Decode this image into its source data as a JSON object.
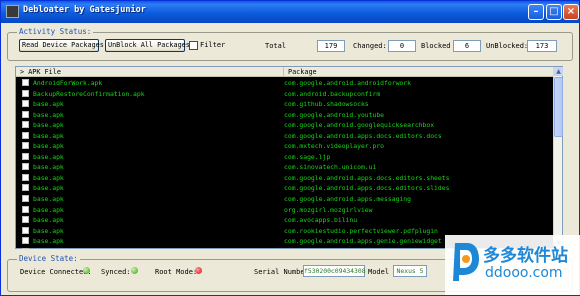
{
  "window": {
    "title": "Debloater by Gatesjunior"
  },
  "activity": {
    "legend": "Activity Status:",
    "read_button": "Read Device Packages",
    "unblock_button": "UnBlock All Packages",
    "filter_label": "Filter",
    "total_label": "Total",
    "total_value": "179",
    "changed_label": "Changed:",
    "changed_value": "0",
    "blocked_label": "Blocked",
    "blocked_value": "6",
    "unblocked_label": "UnBlocked:",
    "unblocked_value": "173"
  },
  "table": {
    "columns": [
      "APK File",
      "Package"
    ],
    "rows": [
      {
        "apk": "AndroidForWork.apk",
        "package": "com.google.android.androidforwork"
      },
      {
        "apk": "BackupRestoreConfirmation.apk",
        "package": "com.android.backupconfirm"
      },
      {
        "apk": "base.apk",
        "package": "com.github.shadowsocks"
      },
      {
        "apk": "base.apk",
        "package": "com.google.android.youtube"
      },
      {
        "apk": "base.apk",
        "package": "com.google.android.googlequicksearchbox"
      },
      {
        "apk": "base.apk",
        "package": "com.google.android.apps.docs.editors.docs"
      },
      {
        "apk": "base.apk",
        "package": "com.mxtech.videoplayer.pro"
      },
      {
        "apk": "base.apk",
        "package": "com.sage.ljp"
      },
      {
        "apk": "base.apk",
        "package": "com.sinovatech.unicom.ui"
      },
      {
        "apk": "base.apk",
        "package": "com.google.android.apps.docs.editors.sheets"
      },
      {
        "apk": "base.apk",
        "package": "com.google.android.apps.docs.editors.slides"
      },
      {
        "apk": "base.apk",
        "package": "com.google.android.apps.messaging"
      },
      {
        "apk": "base.apk",
        "package": "org.mozgirl.mozgirlview"
      },
      {
        "apk": "base.apk",
        "package": "com.avocapps.bilinu"
      },
      {
        "apk": "base.apk",
        "package": "com.rookiestudio.perfectviewer.pdfplugin"
      },
      {
        "apk": "base.apk",
        "package": "com.google.android.apps.genie.geniewidget"
      },
      {
        "apk": "base.apk",
        "package": "com.rookiestudio.perfectviewer"
      }
    ]
  },
  "device": {
    "legend": "Device State:",
    "connected_label": "Device Connected:",
    "synced_label": "Synced:",
    "root_label": "Root Mode:",
    "serial_label": "Serial Number",
    "serial_value": "f530200c09434308",
    "model_label": "Model",
    "model_value": "Nexus 5"
  },
  "watermark": {
    "cn": "多多软件站",
    "en": "ddooo.com"
  },
  "colors": {
    "list_background": "#000000",
    "list_text": "#18d818",
    "status_green": "#3c9e18",
    "status_red": "#d01010",
    "titlebar": "#0a5ae8"
  }
}
